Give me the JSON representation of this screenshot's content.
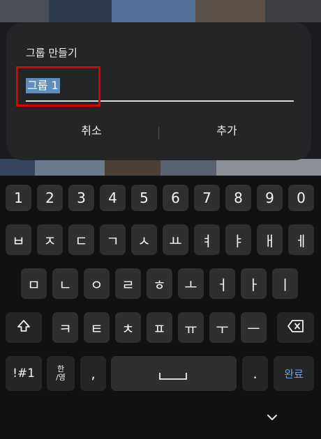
{
  "dialog": {
    "title": "그룹 만들기",
    "input_value": "그룹 1",
    "cancel_label": "취소",
    "add_label": "추가"
  },
  "keyboard": {
    "number_row": [
      "1",
      "2",
      "3",
      "4",
      "5",
      "6",
      "7",
      "8",
      "9",
      "0"
    ],
    "row1": [
      "ㅂ",
      "ㅈ",
      "ㄷ",
      "ㄱ",
      "ㅅ",
      "ㅛ",
      "ㅕ",
      "ㅑ",
      "ㅐ",
      "ㅔ"
    ],
    "row2": [
      "ㅁ",
      "ㄴ",
      "ㅇ",
      "ㄹ",
      "ㅎ",
      "ㅗ",
      "ㅓ",
      "ㅏ",
      "ㅣ"
    ],
    "row3": [
      "ㅋ",
      "ㅌ",
      "ㅊ",
      "ㅍ",
      "ㅠ",
      "ㅜ",
      "ㅡ"
    ],
    "symbols_label": "!#1",
    "lang_top": "한",
    "lang_bottom": "/영",
    "comma_label": ",",
    "period_label": ".",
    "done_label": "완료",
    "shift_icon": "shift-icon",
    "backspace_icon": "backspace-icon",
    "hide_icon": "chevron-down-icon"
  },
  "colors": {
    "selection": "#5d8dbd",
    "highlight": "#e00000",
    "done": "#6aa4e6"
  }
}
